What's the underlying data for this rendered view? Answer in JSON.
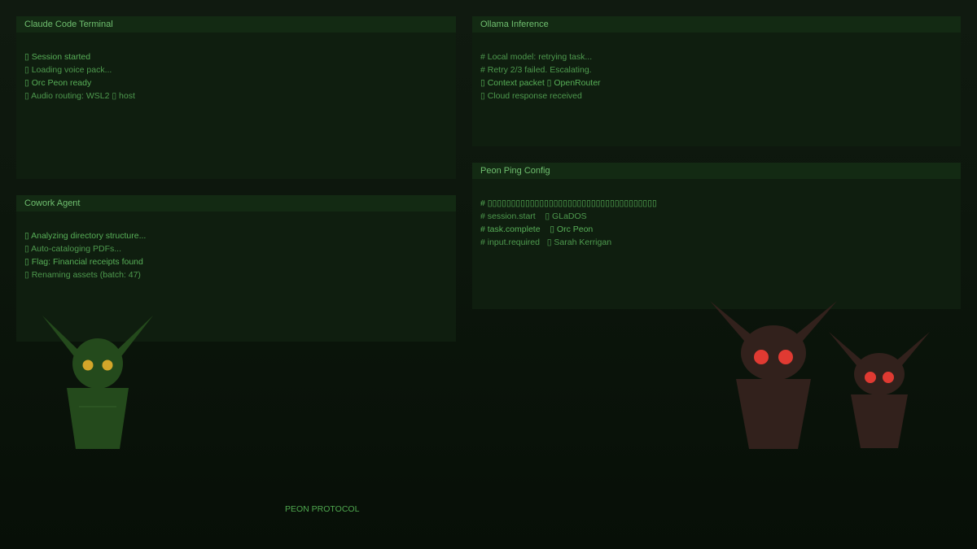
{
  "panels": {
    "claude": {
      "title": "Claude Code Terminal",
      "lines": [
        "▯ Session started",
        "▯ Loading voice pack...",
        "▯ Orc Peon ready",
        "▯ Audio routing: WSL2 ▯ host"
      ]
    },
    "cowork": {
      "title": "Cowork Agent",
      "lines": [
        "▯ Analyzing directory structure...",
        "▯ Auto-cataloging PDFs...",
        "▯ Flag: Financial receipts found",
        "▯ Renaming assets (batch: 47)"
      ]
    },
    "ollama": {
      "title": "Ollama Inference",
      "lines": [
        "# Local model: retrying task...",
        "# Retry 2/3 failed. Escalating.",
        "▯ Context packet ▯ OpenRouter",
        "▯ Cloud response received"
      ]
    },
    "peon": {
      "title": "Peon Ping Config",
      "lines": [
        "# ▯▯▯▯▯▯▯▯▯▯▯▯▯▯▯▯▯▯▯▯▯▯▯▯▯▯▯▯▯▯▯▯▯▯▯▯",
        "# session.start    ▯ GLaDOS",
        "# task.complete    ▯ Orc Peon",
        "# input.required   ▯ Sarah Kerrigan"
      ]
    }
  },
  "footer": {
    "label": "PEON PROTOCOL"
  },
  "colors": {
    "background": "#0c160c",
    "panel": "#0f1e0f",
    "panel_header": "#132a13",
    "text_green": "#58b058",
    "peon_green": "#244a1c",
    "peon_eyes": "#d4a62a",
    "enemy_brown": "#32211c",
    "enemy_eyes": "#e03a32"
  },
  "icons": {
    "left_creature": "orc-peon-icon",
    "right_creatures": "red-eyed-imp-icon"
  }
}
